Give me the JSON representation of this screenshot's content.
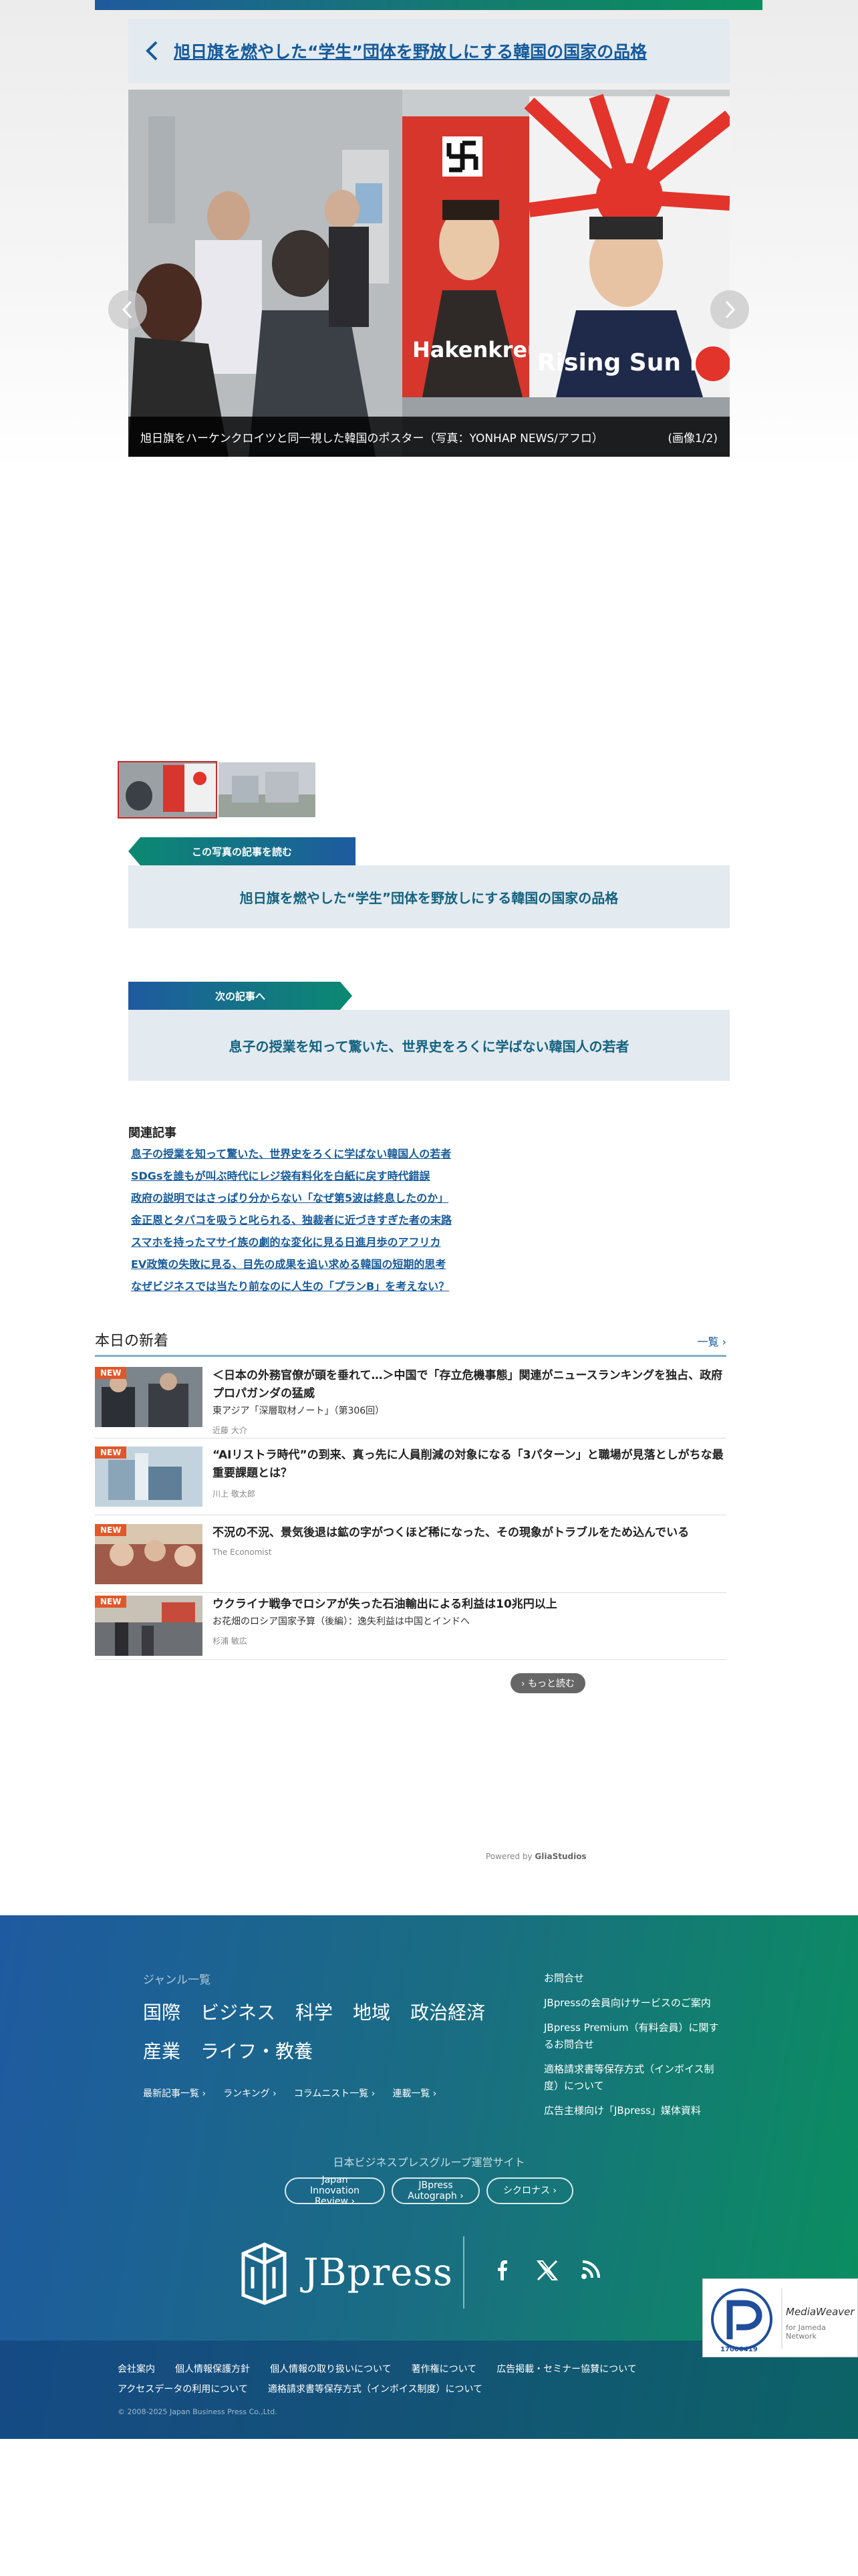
{
  "article": {
    "title": "旭日旗を燃やした“学生”団体を野放しにする韓国の国家の品格"
  },
  "photo": {
    "caption": "旭日旗をハーケンクロイツと同一視した韓国のポスター（写真：YONHAP NEWS/アフロ）",
    "counter": "(画像1/2)",
    "poster_left_text": "Hakenkreuz",
    "poster_right_text": "Rising Sun Flag"
  },
  "photo_article": {
    "tab_label": "この写真の記事を読む",
    "link": "旭日旗を燃やした“学生”団体を野放しにする韓国の国家の品格"
  },
  "next_article": {
    "tab_label": "次の記事へ",
    "link": "息子の授業を知って驚いた、世界史をろくに学ばない韓国人の若者"
  },
  "related": {
    "title": "関連記事",
    "items": [
      "息子の授業を知って驚いた、世界史をろくに学ばない韓国人の若者",
      "SDGsを誰もが叫ぶ時代にレジ袋有料化を白紙に戻す時代錯誤",
      "政府の説明ではさっぱり分からない「なぜ第5波は終息したのか」",
      "金正恩とタバコを吸うと叱られる、独裁者に近づきすぎた者の末路",
      "スマホを持ったマサイ族の劇的な変化に見る日進月歩のアフリカ",
      "EV政策の失敗に見る、目先の成果を追い求める韓国の短期的思考",
      "なぜビジネスでは当たり前なのに人生の「プランB」を考えない？"
    ]
  },
  "news": {
    "heading": "本日の新着",
    "more_label": "一覧 ›",
    "badge": "NEW",
    "items": [
      {
        "title": "＜日本の外務官僚が頭を垂れて…＞中国で「存立危機事態」関連がニュースランキングを独占、政府プロパガンダの猛威",
        "sub": "東アジア「深層取材ノート」（第306回）",
        "author": "近藤 大介"
      },
      {
        "title": "“AIリストラ時代”の到来、真っ先に人員削減の対象になる「3パターン」と職場が見落としがちな最重要課題とは？",
        "sub": "",
        "author": "川上 敬太郎"
      },
      {
        "title": "不況の不況、景気後退は鉱の字がつくほど稀になった、その現象がトラブルをため込んでいる",
        "sub": "",
        "author": "The Economist"
      },
      {
        "title": "ウクライナ戦争でロシアが失った石油輸出による利益は10兆円以上",
        "sub": "お花畑のロシア国家予算（後編）：逸失利益は中国とインドへ",
        "author": "杉浦 敏広"
      }
    ],
    "read_more": "› もっと読む"
  },
  "powered": {
    "prefix": "Powered by",
    "brand": "GliaStudios"
  },
  "footer": {
    "genre_label": "ジャンル一覧",
    "genres_row1": [
      "国際",
      "ビジネス",
      "科学",
      "地域",
      "政治経済"
    ],
    "genres_row2": [
      "産業",
      "ライフ・教養"
    ],
    "links": [
      "最新記事一覧 ›",
      "ランキング ›",
      "コラムニスト一覧 ›",
      "連載一覧 ›"
    ],
    "right_links": [
      "お問合せ",
      "JBpressの会員向けサービスのご案内",
      "JBpress Premium（有料会員）に関するお問合せ",
      "適格請求書等保存方式（インボイス制度）について",
      "広告主様向け「JBpress」媒体資料"
    ],
    "group_label": "日本ビジネスプレスグループ運営サイト",
    "group_sites": [
      "Japan Innovation Review ›",
      "JBpress Autograph ›",
      "シクロナス ›"
    ],
    "logo": "JBpress",
    "bottom_links_row1": [
      "会社案内",
      "個人情報保護方針",
      "個人情報の取り扱いについて",
      "著作権について",
      "広告掲載・セミナー協賛について"
    ],
    "bottom_links_row2": [
      "アクセスデータの利用について",
      "適格請求書等保存方式（インボイス制度）について"
    ],
    "copyright": "© 2008-2025 Japan Business Press Co.,Ltd."
  },
  "privacy_mark": {
    "number": "17000419",
    "partner": "MediaWeaver",
    "partner_sub": "for Jameda Network"
  },
  "colors": {
    "accent": "#155a9a",
    "green": "#0a8f5e",
    "badge": "#e0572a"
  }
}
